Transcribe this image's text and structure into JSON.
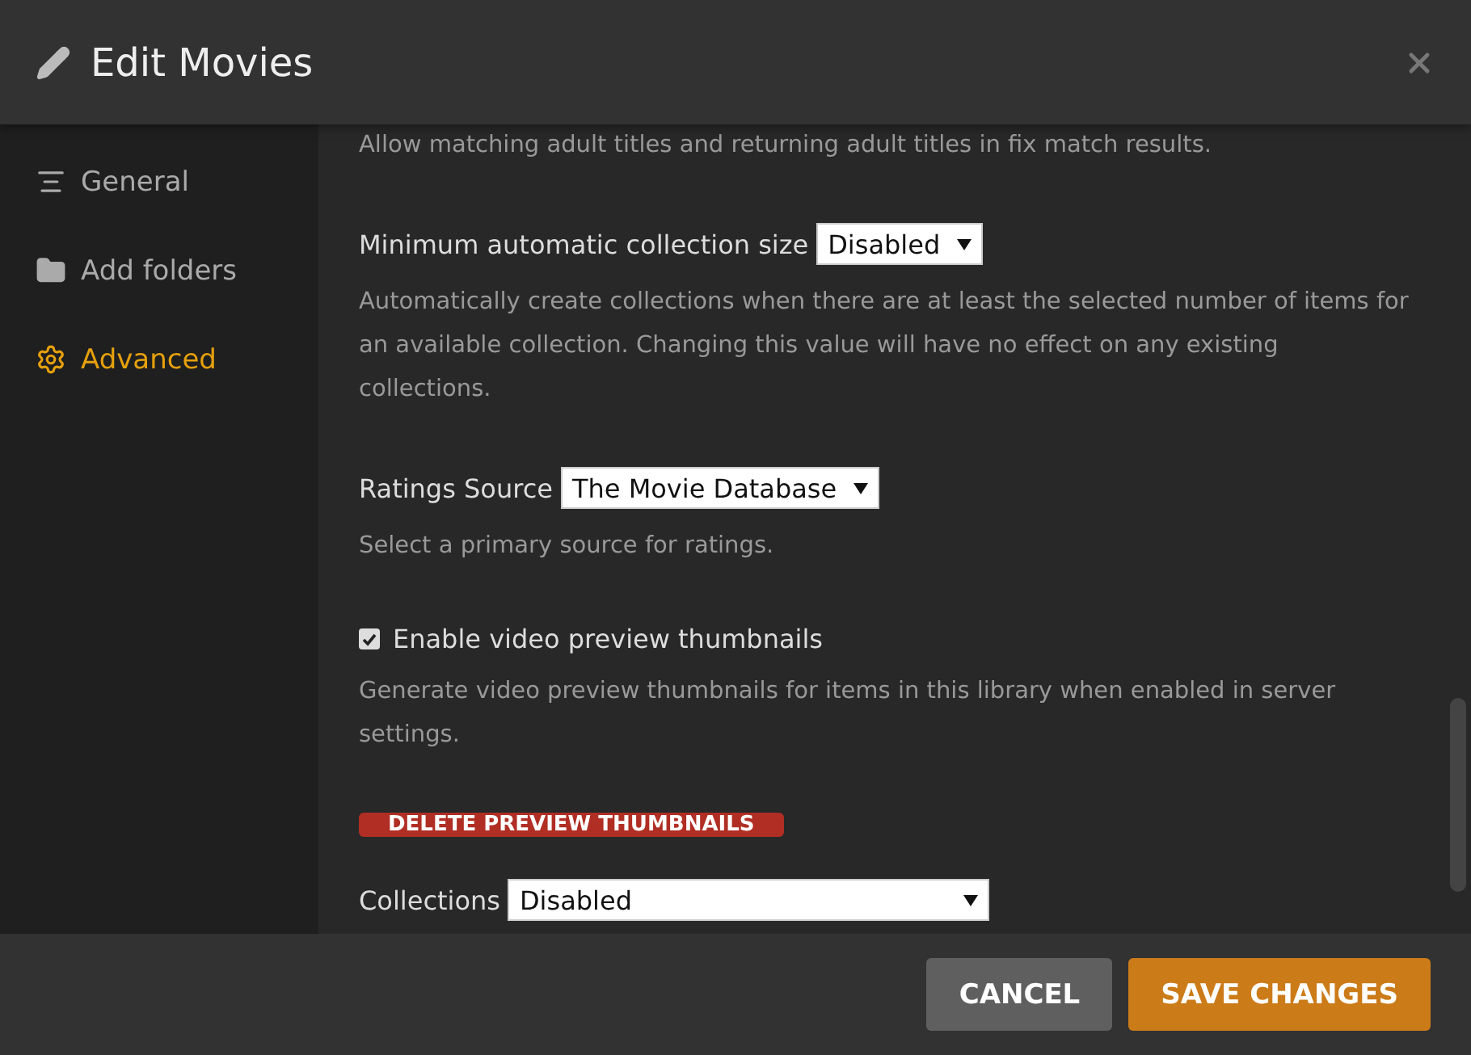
{
  "window": {
    "title": "Edit Movies"
  },
  "sidebar": {
    "items": [
      {
        "label": "General",
        "selected": false
      },
      {
        "label": "Add folders",
        "selected": false
      },
      {
        "label": "Advanced",
        "selected": true
      }
    ]
  },
  "settings": [
    {
      "kind": "note",
      "text": "Allow matching adult titles and returning adult titles in fix match results."
    },
    {
      "kind": "select",
      "label": "Minimum automatic collection size",
      "value": "Disabled"
    },
    {
      "kind": "note",
      "text": "Automatically create collections when there are at least the selected number of items for an available collection. Changing this value will have no effect on any existing collections."
    },
    {
      "kind": "select",
      "label": "Ratings Source",
      "value": "The Movie Database"
    },
    {
      "kind": "note",
      "text": "Select a primary source for ratings."
    },
    {
      "kind": "checkbox",
      "label": "Enable video preview thumbnails",
      "checked": true
    },
    {
      "kind": "note",
      "text": "Generate video preview thumbnails for items in this library when enabled in server settings."
    },
    {
      "kind": "danger",
      "label": "DELETE PREVIEW THUMBNAILS"
    },
    {
      "kind": "wideselect",
      "label": "Collections",
      "value": "Disabled"
    }
  ],
  "buttons": [
    {
      "kind": "cancel",
      "label": "CANCEL"
    },
    {
      "kind": "save",
      "label": "SAVE CHANGES"
    }
  ]
}
